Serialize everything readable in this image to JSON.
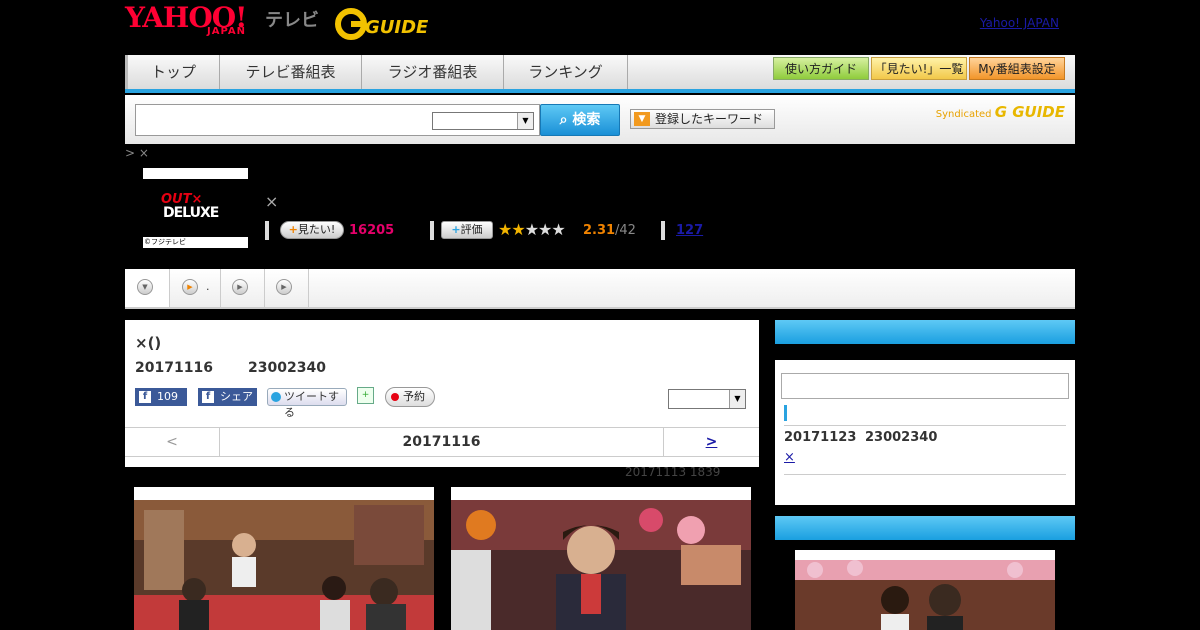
{
  "header": {
    "brand": "YAHOO!",
    "brand_sub": "JAPAN",
    "service": "テレビ",
    "gguide": "GUIDE",
    "yahoo_link": "Yahoo! JAPAN"
  },
  "nav": {
    "tabs": [
      "トップ",
      "テレビ番組表",
      "ラジオ番組表",
      "ランキング"
    ],
    "right_buttons": [
      "使い方ガイド",
      "「見たい!」一覧",
      "My番組表設定"
    ]
  },
  "search": {
    "input_value": "",
    "button_label": "検索",
    "keyword_button": "登録したキーワード",
    "syndicated_label": "Syndicated",
    "syndicated_brand": "G GUIDE"
  },
  "breadcrumb": "> ×",
  "program": {
    "logo_top": "OUT×",
    "logo_main": "DELUXE",
    "copyright": "©フジテレビ",
    "title_suffix": "×",
    "want_label": "見たい!",
    "want_count": "16205",
    "review_label": "評価",
    "rating": "2.31",
    "rating_count": "/42",
    "comments_link": "127"
  },
  "subtabs": [
    {
      "label": ""
    },
    {
      "label": "."
    },
    {
      "label": ""
    },
    {
      "label": ""
    }
  ],
  "episode": {
    "title": "×()",
    "date": "20171116",
    "time": "23002340",
    "fb_like_count": "109",
    "fb_share": "シェア",
    "tweet": "ツイートする",
    "reserve": "予約",
    "prev": "<",
    "current_date": "20171116",
    "next": ">",
    "updated": "20171113  1839"
  },
  "sidebar": {
    "next_date": "20171123",
    "next_time": "23002340",
    "next_link": "×"
  },
  "colors": {
    "accent": "#2aa3e0",
    "brand_red": "#ff0033",
    "want_pink": "#e5006a",
    "rating_orange": "#f08300",
    "link": "#1a1aa6"
  }
}
